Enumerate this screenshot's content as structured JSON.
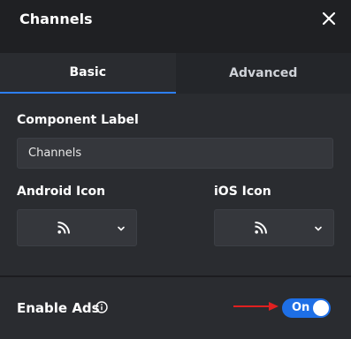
{
  "header": {
    "title": "Channels",
    "close_icon": "close-icon"
  },
  "tabs": [
    {
      "label": "Basic",
      "active": true
    },
    {
      "label": "Advanced",
      "active": false
    }
  ],
  "form": {
    "component_label": "Component Label",
    "component_value": "Channels",
    "android_icon_label": "Android Icon",
    "ios_icon_label": "iOS Icon",
    "android_icon": "rss-icon",
    "ios_icon": "rss-icon"
  },
  "ads": {
    "label": "Enable Ads",
    "info_icon": "info-icon",
    "toggle_text": "On",
    "enabled": true,
    "accent_color": "#1e6fe6",
    "arrow_color": "#e02020"
  }
}
